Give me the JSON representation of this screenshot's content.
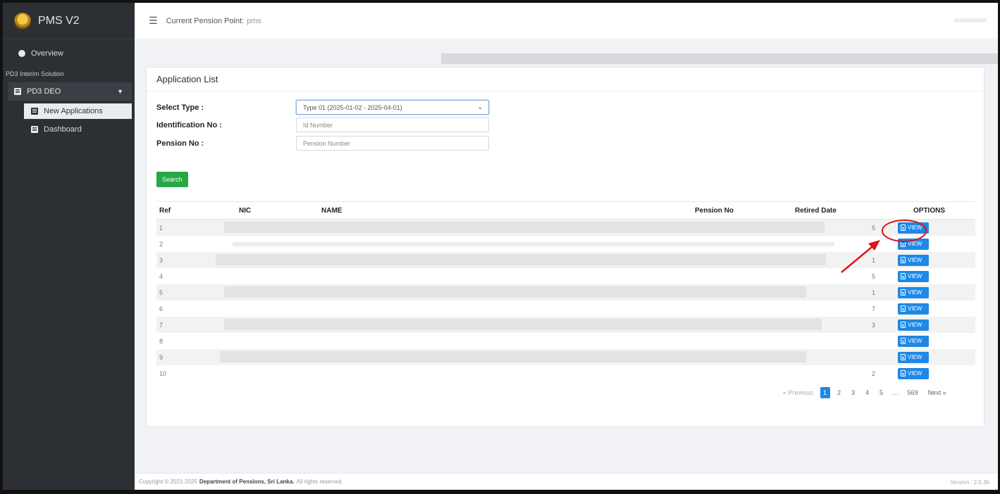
{
  "brand": {
    "name": "PMS V2"
  },
  "sidebar": {
    "overview": "Overview",
    "section": "PD3 Interim Solution",
    "group": "PD3 DEO",
    "items": [
      {
        "label": "New Applications",
        "active": true
      },
      {
        "label": "Dashboard",
        "active": false
      }
    ]
  },
  "topbar": {
    "label": "Current Pension Point:",
    "value": "pms"
  },
  "card": {
    "title": "Application List",
    "form": {
      "type_label": "Select Type :",
      "type_value": "Type 01  (2025-01-02 - 2025-04-01)",
      "id_label": "Identification No :",
      "id_placeholder": "Id Number",
      "pension_label": "Pension No :",
      "pension_placeholder": "Pension Number"
    },
    "search_label": "Search"
  },
  "table": {
    "columns": [
      "Ref",
      "NIC",
      "NAME",
      "Pension No",
      "Retired Date",
      "OPTIONS"
    ],
    "rows": [
      {
        "ref": "1",
        "retired": "5"
      },
      {
        "ref": "2",
        "retired": ""
      },
      {
        "ref": "3",
        "retired": "1"
      },
      {
        "ref": "4",
        "retired": "5"
      },
      {
        "ref": "5",
        "retired": "1"
      },
      {
        "ref": "6",
        "retired": "7"
      },
      {
        "ref": "7",
        "retired": "3"
      },
      {
        "ref": "8",
        "retired": ""
      },
      {
        "ref": "9",
        "retired": ""
      },
      {
        "ref": "10",
        "retired": "2"
      }
    ],
    "view_label": "VIEW"
  },
  "pagination": {
    "previous": "« Previous",
    "pages": [
      "1",
      "2",
      "3",
      "4",
      "5",
      "…",
      "569"
    ],
    "active": "1",
    "next": "Next »"
  },
  "footer": {
    "prefix": "Copyright © 2021-2025",
    "org": "Department of Pensions, Sri Lanka.",
    "suffix": "All rights reserved.",
    "version": "Version : 2.5.36"
  },
  "colors": {
    "accent": "#1e88e5",
    "success": "#28a745",
    "annotation": "#e3101a",
    "sidebar": "#2c2f33"
  }
}
